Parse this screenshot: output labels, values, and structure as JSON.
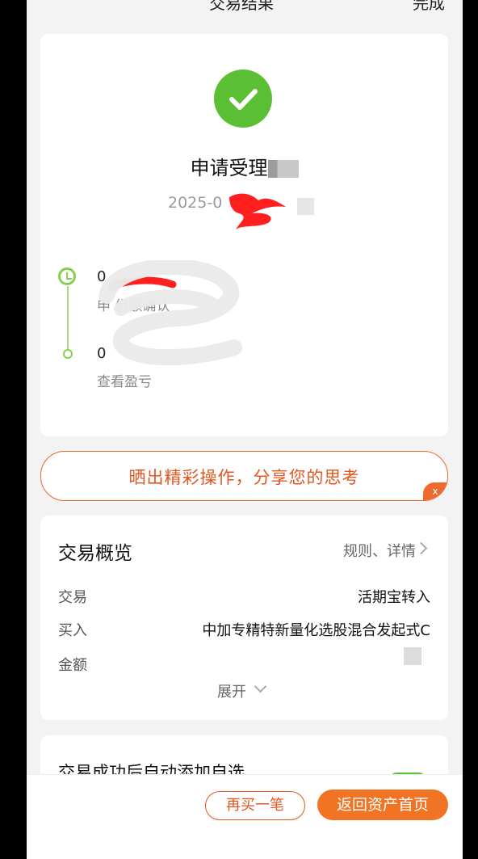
{
  "nav": {
    "title": "交易结果",
    "right_action": "完成"
  },
  "status": {
    "title": "申请受理",
    "date": "2025-0",
    "steps": [
      {
        "time": "0",
        "desc": "申 份额确认"
      },
      {
        "time": "0",
        "desc": "查看盈亏"
      }
    ]
  },
  "share": {
    "text": "晒出精彩操作，分享您的思考",
    "close": "x"
  },
  "overview": {
    "title": "交易概览",
    "link": "规则、详情",
    "rows": [
      {
        "label": "交易",
        "value": "活期宝转入"
      },
      {
        "label": "买入",
        "value": "中加专精特新量化选股混合发起式C"
      },
      {
        "label": "金额",
        "value": ""
      }
    ],
    "expand": "展开"
  },
  "auto_add": {
    "label": "交易成功后自动添加自选"
  },
  "footer": {
    "buy_again": "再买一笔",
    "back_home": "返回资产首页"
  },
  "colors": {
    "accent": "#f07424",
    "success": "#5bbf33",
    "text_orange": "#e2561f"
  },
  "icons": [
    "check-icon",
    "clock-icon",
    "chevron-right-icon",
    "chevron-down-icon",
    "close-icon"
  ]
}
